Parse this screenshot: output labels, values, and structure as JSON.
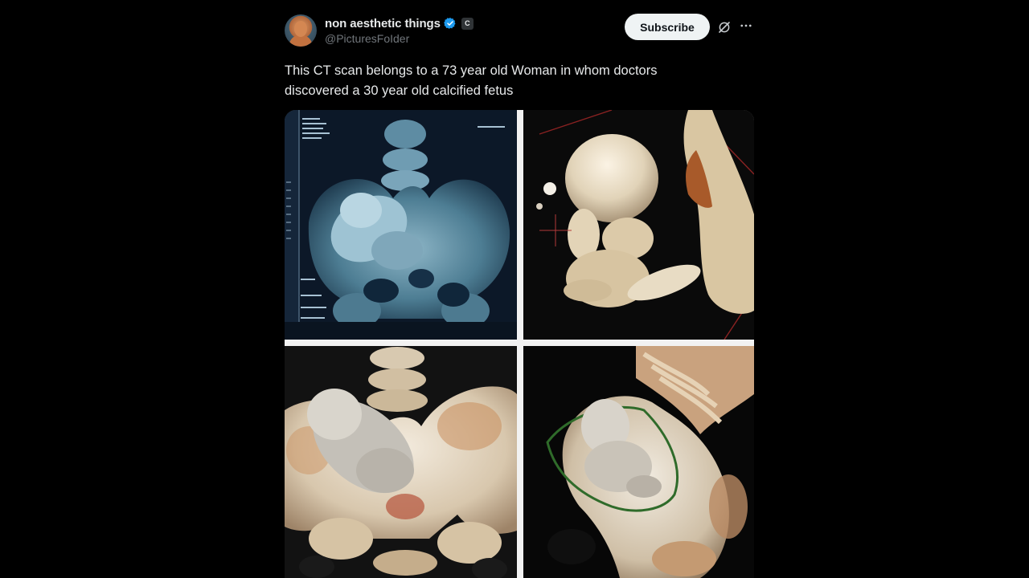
{
  "author": {
    "display_name": "non aesthetic things",
    "handle": "@PicturesFoIder",
    "affiliate_badge": "C",
    "verified_icon": "verified-badge-icon",
    "verified_color": "#1d9bf0"
  },
  "actions": {
    "subscribe_label": "Subscribe",
    "grok_icon": "grok-icon",
    "more_icon": "more-options-icon"
  },
  "tweet": {
    "text_line1": "This CT scan belongs to a 73 year old Woman in whom doctors",
    "text_line2": "discovered a 30 year old calcified fetus"
  },
  "media": {
    "images": [
      {
        "name": "ct-scan-blue-pelvis"
      },
      {
        "name": "ct-scan-3d-fetus-closeup"
      },
      {
        "name": "ct-scan-3d-pelvis-fetus"
      },
      {
        "name": "ct-scan-3d-fetus-outlined"
      }
    ]
  }
}
